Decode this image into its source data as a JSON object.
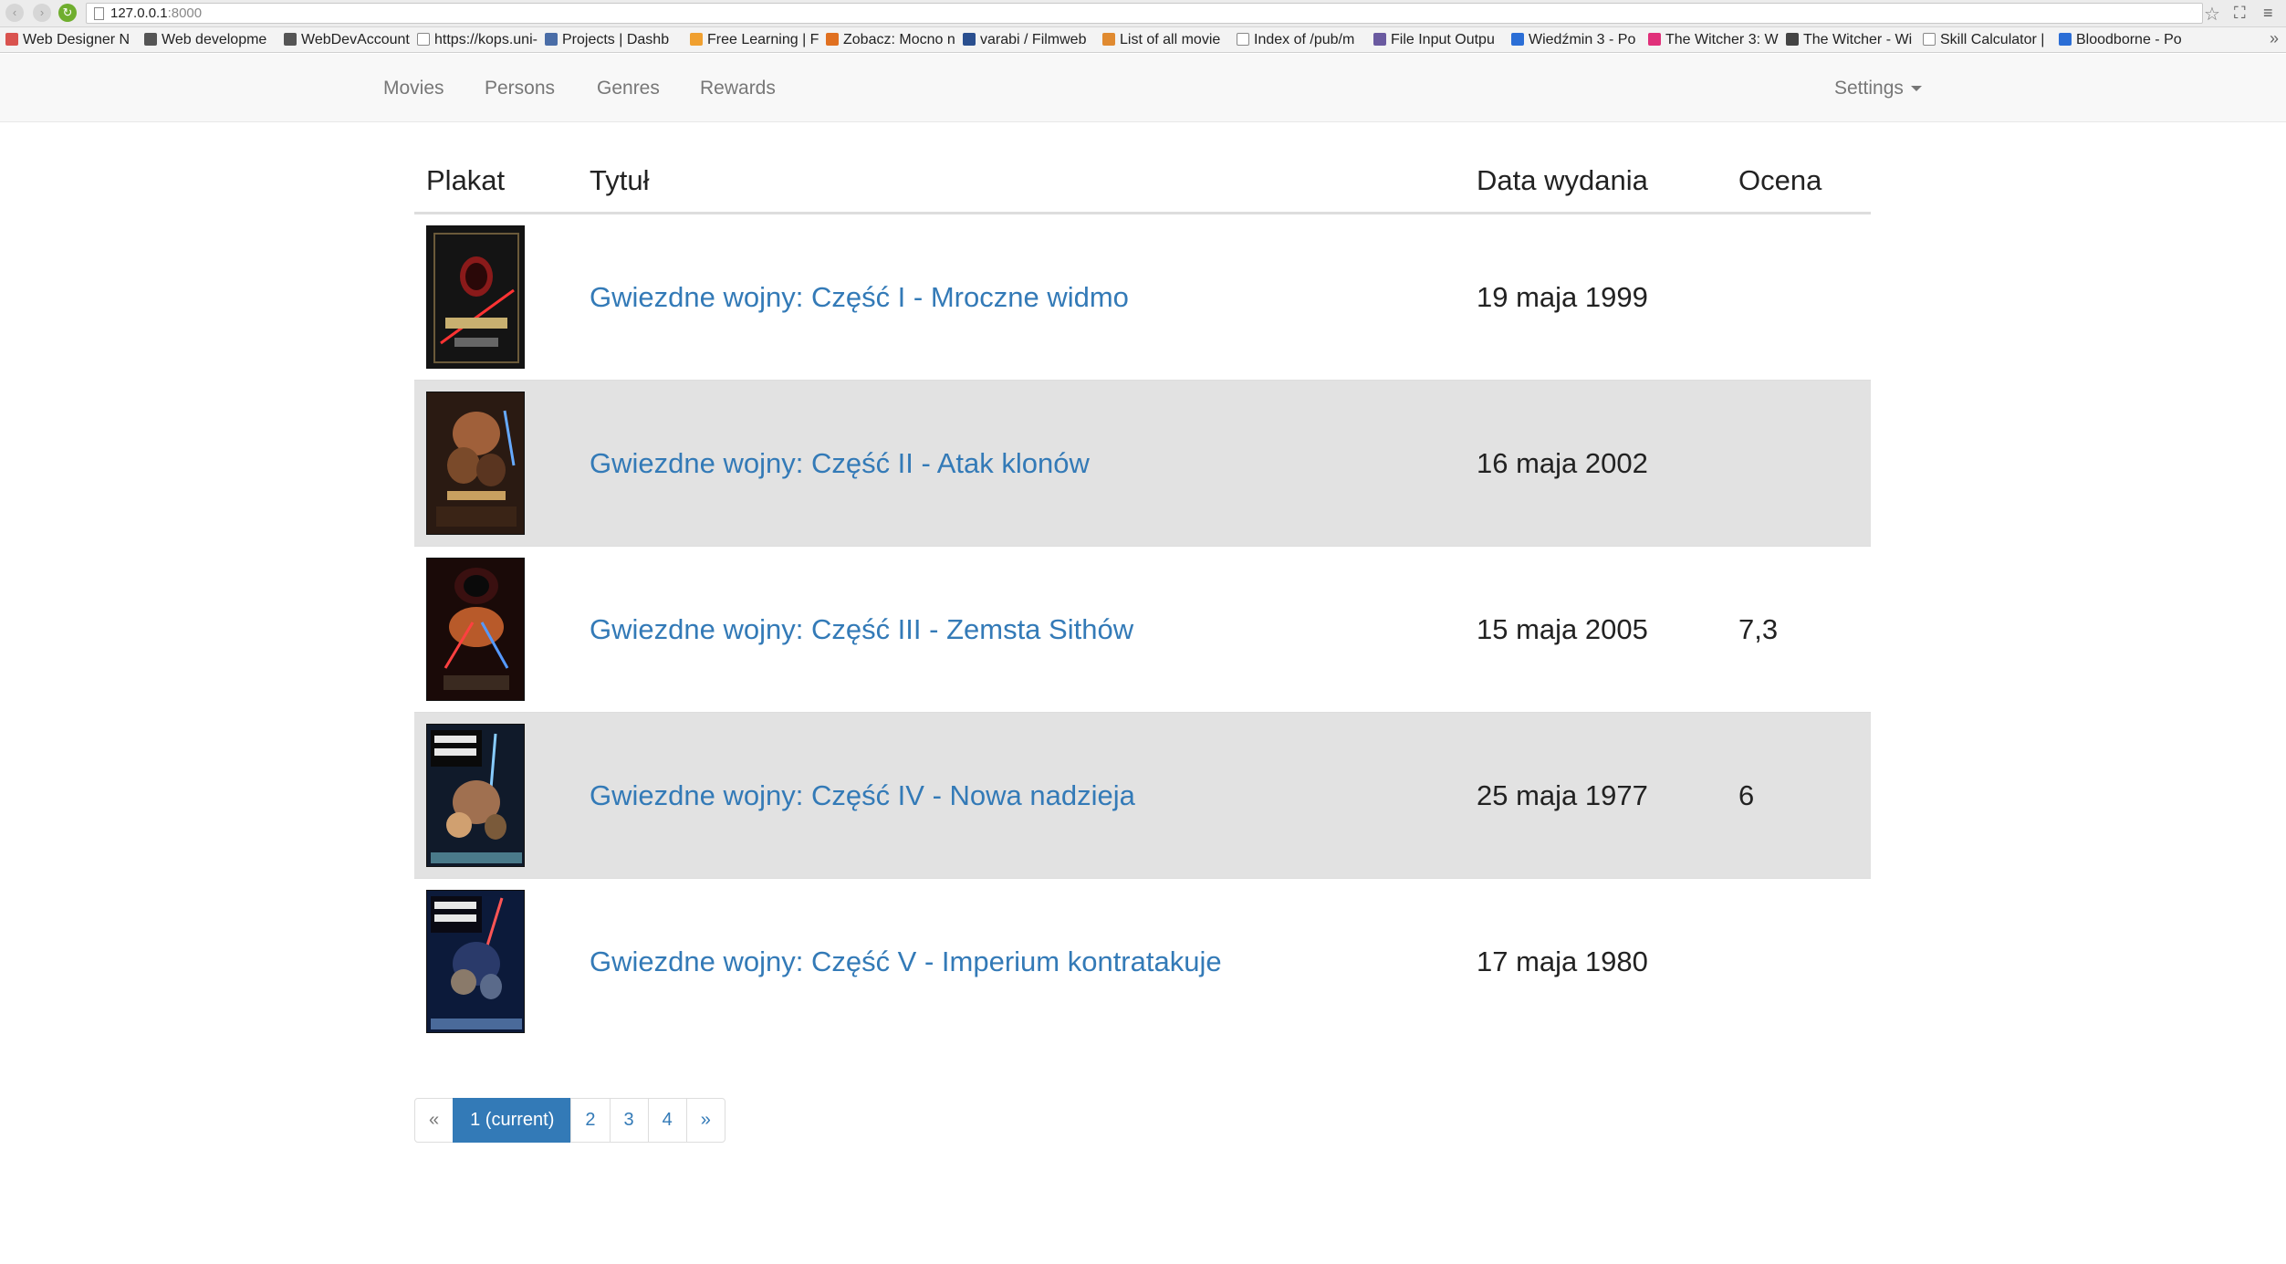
{
  "browser": {
    "url_host": "127.0.0.1",
    "url_port": ":8000",
    "bookmarks": [
      {
        "label": "Web Designer N",
        "color": "#d9534f"
      },
      {
        "label": "Web developme",
        "color": "#555555"
      },
      {
        "label": "WebDevAccount",
        "color": "#555555"
      },
      {
        "label": "https://kops.uni-",
        "color": "#ffffff"
      },
      {
        "label": "Projects | Dashb",
        "color": "#4a6da7"
      },
      {
        "label": "Free Learning | F",
        "color": "#f0a030"
      },
      {
        "label": "Zobacz: Mocno n",
        "color": "#e07020"
      },
      {
        "label": "varabi / Filmweb",
        "color": "#2a4f8f"
      },
      {
        "label": "List of all movie",
        "color": "#e08a30"
      },
      {
        "label": "Index of /pub/m",
        "color": "#ffffff"
      },
      {
        "label": "File Input Outpu",
        "color": "#6a5aa0"
      },
      {
        "label": "Wiedźmin 3 - Po",
        "color": "#2b6ed6"
      },
      {
        "label": "The Witcher 3: W",
        "color": "#e0307a"
      },
      {
        "label": "The Witcher - Wi",
        "color": "#444444"
      },
      {
        "label": "Skill Calculator |",
        "color": "#ffffff"
      },
      {
        "label": "Bloodborne - Po",
        "color": "#2b6ed6"
      }
    ]
  },
  "navbar": {
    "links": [
      "Movies",
      "Persons",
      "Genres",
      "Rewards"
    ],
    "settings_label": "Settings"
  },
  "table": {
    "headers": {
      "poster": "Plakat",
      "title": "Tytuł",
      "release_date": "Data wydania",
      "rating": "Ocena"
    },
    "rows": [
      {
        "title": "Gwiezdne wojny: Część I - Mroczne widmo",
        "release_date": "19 maja 1999",
        "rating": ""
      },
      {
        "title": "Gwiezdne wojny: Część II - Atak klonów",
        "release_date": "16 maja 2002",
        "rating": ""
      },
      {
        "title": "Gwiezdne wojny: Część III - Zemsta Sithów",
        "release_date": "15 maja 2005",
        "rating": "7,3"
      },
      {
        "title": "Gwiezdne wojny: Część IV - Nowa nadzieja",
        "release_date": "25 maja 1977",
        "rating": "6"
      },
      {
        "title": "Gwiezdne wojny: Część V - Imperium kontratakuje",
        "release_date": "17 maja 1980",
        "rating": ""
      }
    ]
  },
  "pagination": {
    "prev": "«",
    "pages": [
      "1 (current)",
      "2",
      "3",
      "4"
    ],
    "next": "»"
  },
  "colors": {
    "link": "#337ab7",
    "active_page_bg": "#337ab7",
    "stripe": "#e2e2e2"
  }
}
